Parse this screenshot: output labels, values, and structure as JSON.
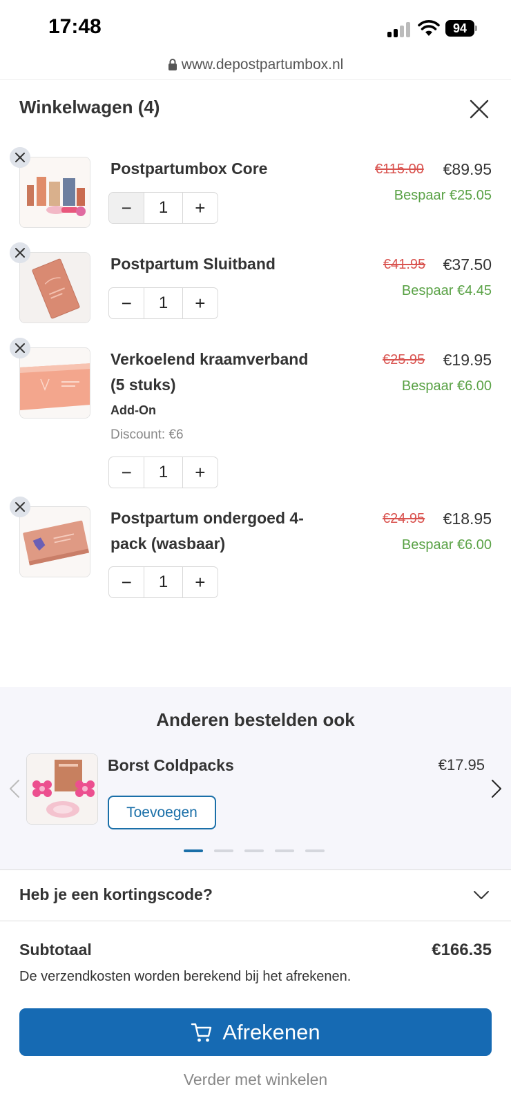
{
  "status_bar": {
    "time": "17:48",
    "battery": "94"
  },
  "browser": {
    "url": "www.depostpartumbox.nl"
  },
  "cart": {
    "title": "Winkelwagen (4)",
    "items": [
      {
        "name": "Postpartumbox Core",
        "old_price": "€115.00",
        "price": "€89.95",
        "savings": "Bespaar €25.05",
        "quantity": "1"
      },
      {
        "name": "Postpartum Sluitband",
        "old_price": "€41.95",
        "price": "€37.50",
        "savings": "Bespaar €4.45",
        "quantity": "1"
      },
      {
        "name": "Verkoelend kraamverband (5 stuks)",
        "old_price": "€25.95",
        "price": "€19.95",
        "savings": "Bespaar €6.00",
        "quantity": "1",
        "tag": "Add-On",
        "discount": "Discount: €6"
      },
      {
        "name": "Postpartum ondergoed 4-pack (wasbaar)",
        "old_price": "€24.95",
        "price": "€18.95",
        "savings": "Bespaar €6.00",
        "quantity": "1"
      }
    ],
    "qty_minus": "−",
    "qty_plus": "+"
  },
  "recommendations": {
    "title": "Anderen bestelden ook",
    "product": {
      "name": "Borst Coldpacks",
      "price": "€17.95",
      "add_label": "Toevoegen"
    },
    "page_count": 5,
    "active_page": 1
  },
  "coupon": {
    "label": "Heb je een kortingscode?"
  },
  "summary": {
    "subtotal_label": "Subtotaal",
    "subtotal_value": "€166.35",
    "shipping_note": "De verzendkosten worden berekend bij het afrekenen."
  },
  "actions": {
    "checkout": "Afrekenen",
    "continue": "Verder met winkelen"
  },
  "colors": {
    "primary": "#166ab3",
    "savings": "#5aa246",
    "old_price": "#d9534f"
  }
}
